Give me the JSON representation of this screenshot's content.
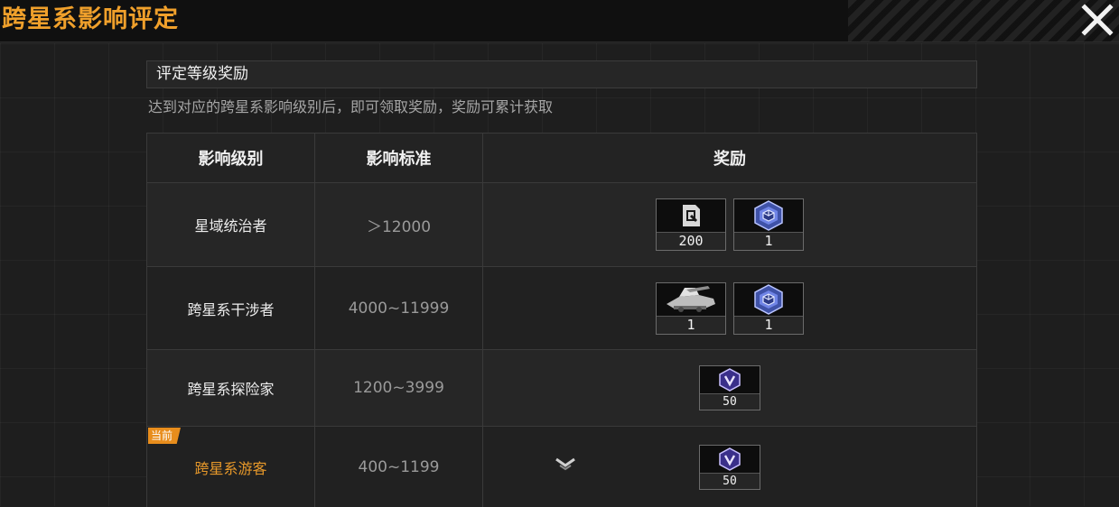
{
  "window": {
    "title": "跨星系影响评定",
    "close_icon": "close-icon"
  },
  "section": {
    "title": "评定等级奖励",
    "description": "达到对应的跨星系影响级别后，即可领取奖励，奖励可累计获取"
  },
  "table": {
    "headers": [
      "影响级别",
      "影响标准",
      "奖励"
    ],
    "rows": [
      {
        "level": "星域统治者",
        "standard": "＞12000",
        "rewards": [
          {
            "icon": "chip-token-icon",
            "count": "200"
          },
          {
            "icon": "blue-cube-badge-icon",
            "count": "1"
          }
        ]
      },
      {
        "level": "跨星系干涉者",
        "standard": "4000~11999",
        "rewards": [
          {
            "icon": "mech-unit-icon",
            "count": "1"
          },
          {
            "icon": "blue-cube-badge-icon",
            "count": "1"
          }
        ]
      },
      {
        "level": "跨星系探险家",
        "standard": "1200~3999",
        "rewards": [
          {
            "icon": "purple-v-badge-icon",
            "count": "50"
          }
        ]
      },
      {
        "level": "跨星系游客",
        "standard": "400~1199",
        "current": true,
        "rewards": [
          {
            "icon": "purple-v-badge-icon",
            "count": "50"
          }
        ]
      }
    ],
    "current_badge": "当前",
    "expand_icon": "chevron-down-icon"
  },
  "colors": {
    "accent": "#f0a02b",
    "current_badge": "#e88d1c"
  }
}
